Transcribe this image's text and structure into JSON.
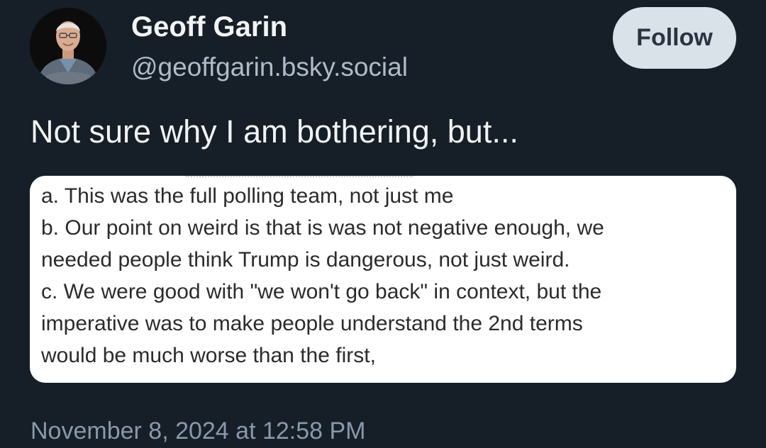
{
  "author": {
    "name": "Geoff Garin",
    "handle": "@geoffgarin.bsky.social"
  },
  "follow_button": {
    "label": "Follow"
  },
  "post": {
    "text": "Not sure why I am bothering, but...",
    "image_text_lines": [
      "a. This was the full polling team, not just me",
      "b. Our point on weird is that is was not negative enough, we",
      "needed people think Trump is dangerous, not just weird.",
      "c. We were good with \"we won't go back\" in context, but the",
      "imperative was to make people understand the 2nd terms",
      "would be much worse than the first,"
    ],
    "timestamp": "November 8, 2024 at 12:58 PM"
  },
  "colors": {
    "background": "#161e27",
    "text_primary": "#f1f3f5",
    "text_secondary": "#aebbc9",
    "timestamp": "#8899aa",
    "follow_button_bg": "#d9e1e9"
  }
}
